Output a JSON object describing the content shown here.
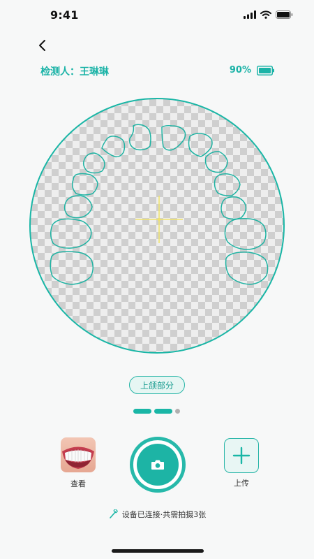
{
  "status_bar": {
    "time": "9:41"
  },
  "header": {
    "inspector_label": "检测人：王琳琳",
    "battery_percent": "90%"
  },
  "scan": {
    "jaw_label": "上颌部分"
  },
  "pager": {
    "count": 3,
    "active_index": 1
  },
  "actions": {
    "view_label": "查看",
    "upload_label": "上传"
  },
  "device": {
    "status_text": "设备已连接·共需拍摄3张"
  },
  "colors": {
    "accent": "#19b6a6",
    "crosshair": "#f0e36a",
    "background": "#f7f8f8"
  },
  "icons": {
    "back": "chevron-left-icon",
    "camera": "camera-icon",
    "plus": "plus-icon",
    "battery": "battery-icon",
    "device": "toothbrush-icon"
  }
}
